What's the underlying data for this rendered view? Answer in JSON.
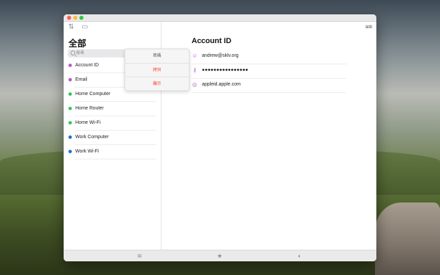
{
  "window": {
    "title_icons": [
      "sort-icon",
      "layout-icon"
    ],
    "edit_label": "編輯"
  },
  "sidebar": {
    "title": "全部",
    "search_placeholder": "搜尋",
    "items": [
      {
        "label": "Account ID",
        "color": "#b35ec4"
      },
      {
        "label": "Email",
        "color": "#b35ec4"
      },
      {
        "label": "Home Computer",
        "color": "#34c759"
      },
      {
        "label": "Home Router",
        "color": "#34c759"
      },
      {
        "label": "Home Wi-Fi",
        "color": "#34c759"
      },
      {
        "label": "Work Computer",
        "color": "#1f6fde"
      },
      {
        "label": "Work Wi-Fi",
        "color": "#1f6fde"
      }
    ]
  },
  "popup": {
    "title": "密碼",
    "copy": "拷貝",
    "show": "顯示"
  },
  "detail": {
    "title": "Account ID",
    "username": "andrew@sklv.org",
    "password": "●●●●●●●●●●●●●●●●",
    "website": "appleid.apple.com"
  },
  "tabs": [
    "layers-icon",
    "star-icon",
    "shield-icon"
  ],
  "colors": {
    "accent": "#b35ec4",
    "destructive": "#ff3b30"
  }
}
